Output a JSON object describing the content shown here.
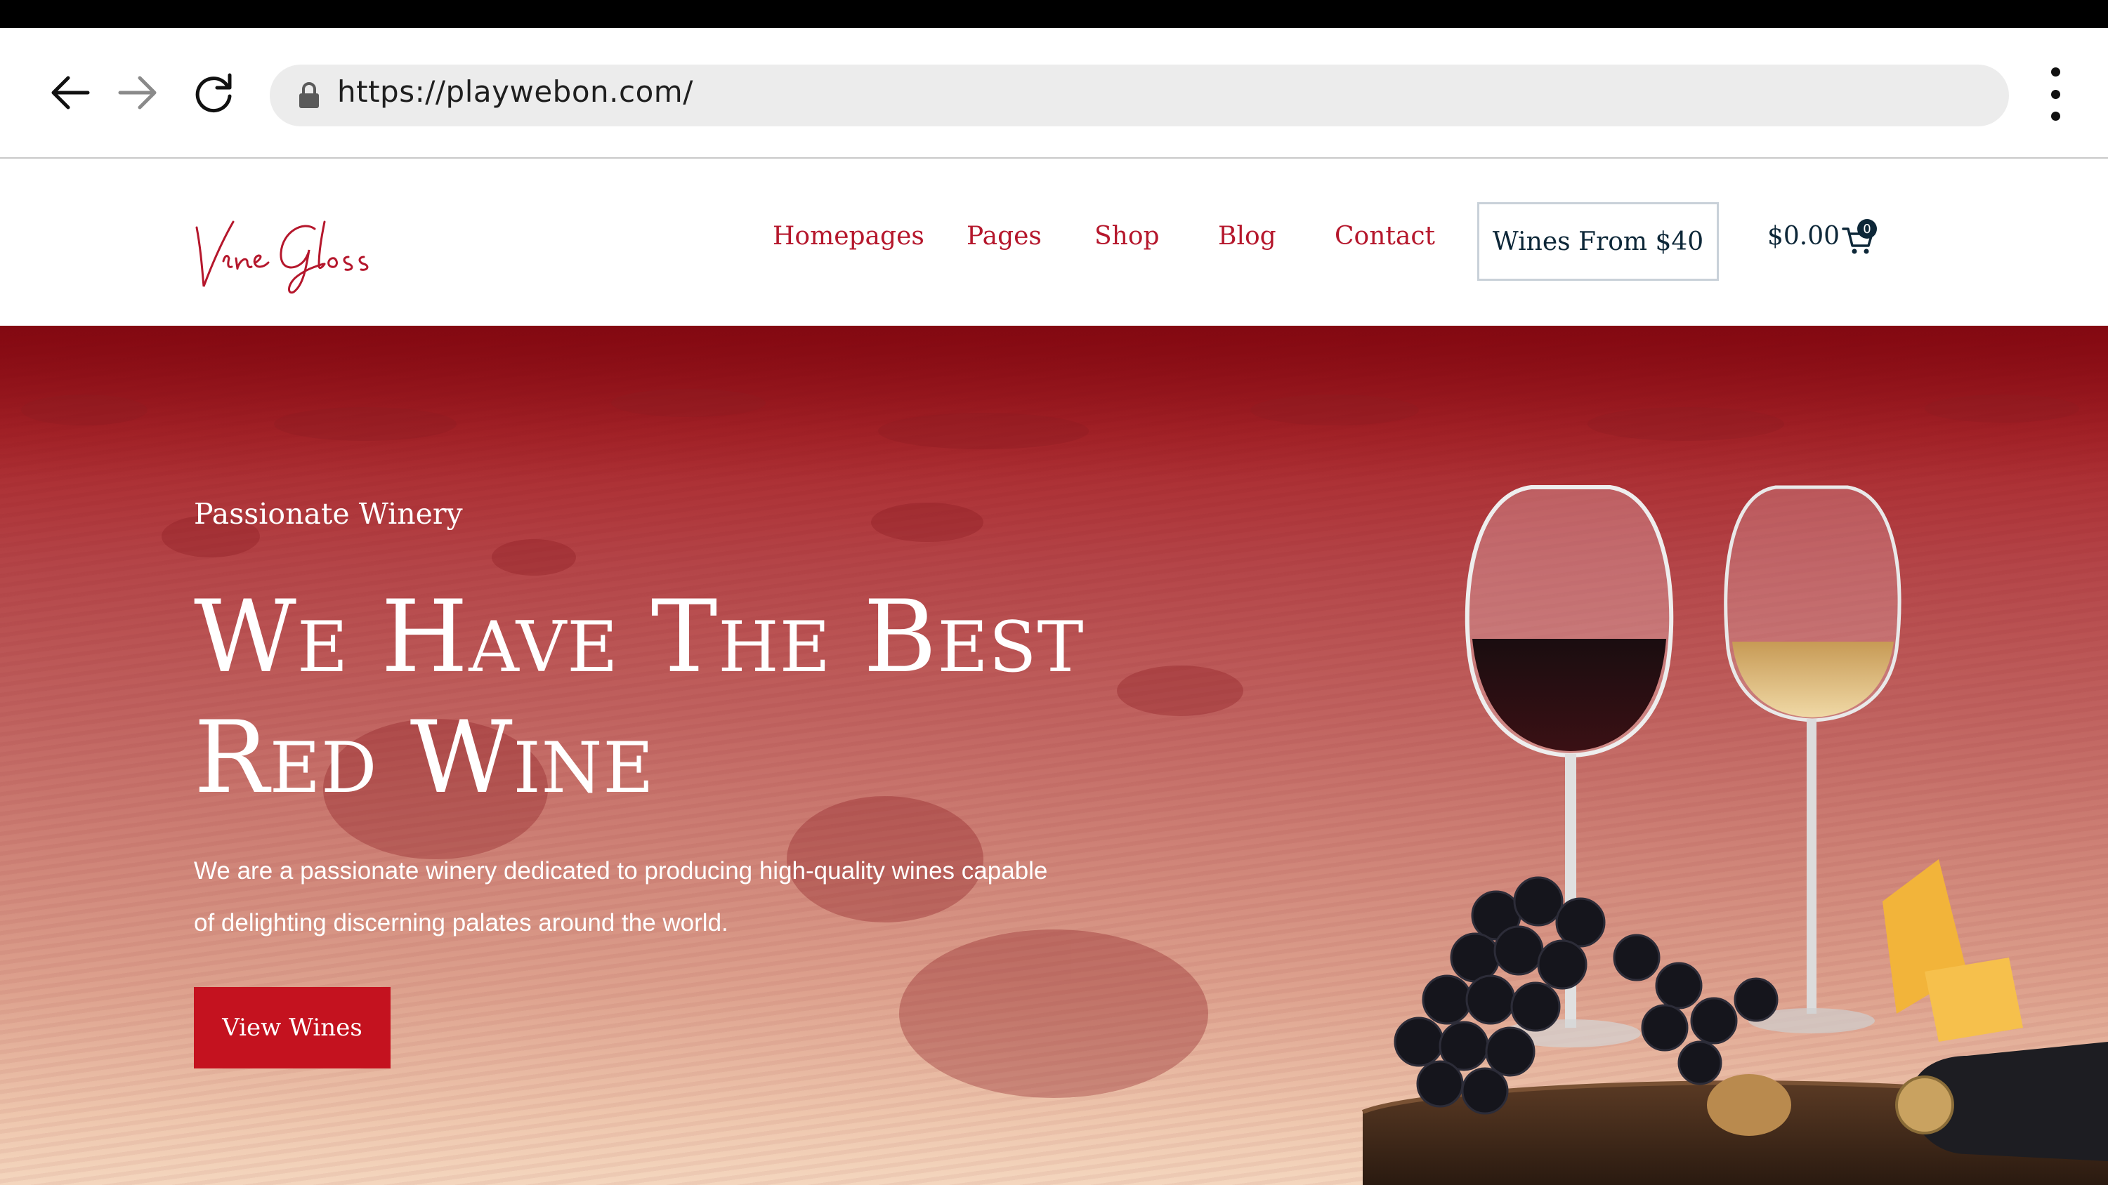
{
  "browser": {
    "url": "https://playwebon.com/",
    "icons": [
      "back-arrow-icon",
      "forward-arrow-icon",
      "reload-icon",
      "lock-icon",
      "more-vertical-icon"
    ]
  },
  "site": {
    "logo_text": "Vine Gloss",
    "menu": [
      "Homepages",
      "Pages",
      "Shop",
      "Blog",
      "Contact"
    ],
    "wines_button": "Wines From $40",
    "cart_price": "$0.00",
    "cart_count": "0"
  },
  "hero": {
    "eyebrow": "Passionate Winery",
    "headline_line1": "We Have The Best",
    "headline_line2": "Red Wine",
    "description": "We are a passionate winery dedicated to producing high-quality wines capable of delighting discerning palates around the world.",
    "cta": "View Wines"
  },
  "colors": {
    "accent": "#c4121f",
    "menu_text": "#b5172c",
    "dark_text": "#0d2738"
  }
}
